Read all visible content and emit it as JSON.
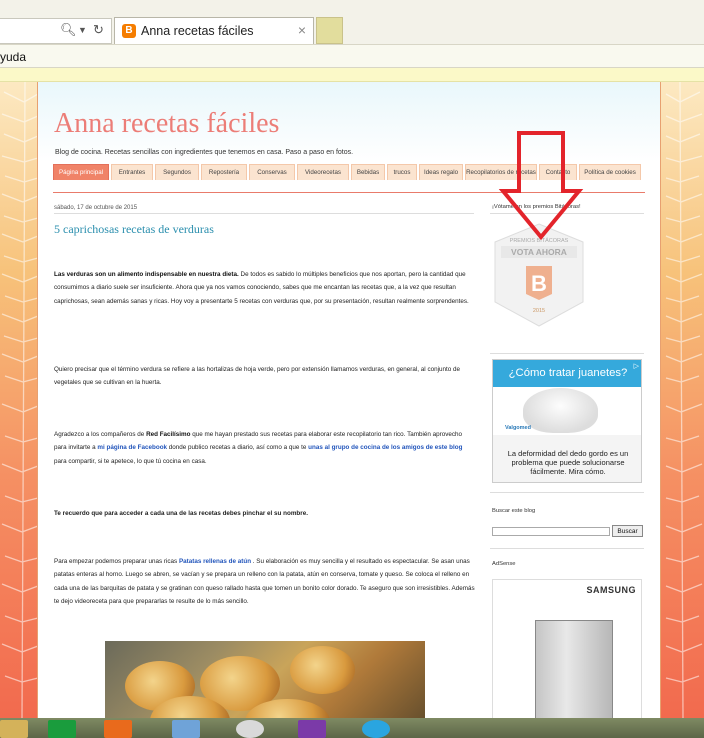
{
  "browser": {
    "tab_title": "Anna recetas fáciles",
    "tab_close": "×",
    "menu_text": "yuda",
    "favicon_letter": "B"
  },
  "blog": {
    "title": "Anna recetas fáciles",
    "description": "Blog de cocina. Recetas sencillas con ingredientes que tenemos en casa. Paso a paso en fotos.",
    "nav_tabs": [
      {
        "label": "Página principal",
        "active": true
      },
      {
        "label": "Entrantes"
      },
      {
        "label": "Segundos"
      },
      {
        "label": "Repostería"
      },
      {
        "label": "Conservas"
      },
      {
        "label": "Videorecetas"
      },
      {
        "label": "Bebidas"
      },
      {
        "label": "trucos"
      },
      {
        "label": "Ideas regalo"
      },
      {
        "label": "Recopilatorios de recetas"
      },
      {
        "label": "Contacto"
      },
      {
        "label": "Política de cookies"
      }
    ]
  },
  "post": {
    "date": "sábado, 17 de octubre de 2015",
    "title": "5 caprichosas recetas de verduras",
    "p1_bold": "Las verduras son un alimento indispensable en nuestra dieta.",
    "p1_rest": " De todos es sabido lo múltiples beneficios que nos aportan, pero la cantidad que consumimos a diario suele ser insuficiente. Ahora que ya nos vamos conociendo, sabes que me encantan las recetas que, a la vez que resultan caprichosas, sean además sanas y ricas. Hoy voy a presentarte 5 recetas con verduras que, por su presentación, resultan realmente sorprendentes.",
    "p2": "Quiero precisar que el término verdura se refiere a las hortalizas de hoja verde, pero por extensión llamamos verduras, en general, al conjunto de vegetales que se cultivan en la huerta.",
    "p3_a": "Agradezco a los compañeros de ",
    "p3_b": "Red Facilísimo",
    "p3_c": " que me hayan prestado sus recetas para elaborar este recopilatorio tan rico. También aprovecho para invitarte a ",
    "p3_link1": "mi página de Facebook",
    "p3_d": " donde publico recetas a diario, así como a que te ",
    "p3_link2": "unas al grupo de cocina de los amigos de este blog",
    "p3_e": " para compartir, si te apetece, lo que tú cocina en casa.",
    "p4": "Te recuerdo que para acceder a cada una de las recetas debes pinchar el su nombre.",
    "p5_a": "Para empezar podemos preparar unas ricas ",
    "p5_link": "Patatas rellenas de atún",
    "p5_b": " . Su elaboración es muy sencilla y el resultado es espectacular. Se asan unas patatas enteras al horno. Luego se abren, se vacían y se prepara un relleno con la patata, atún en conserva, tomate y queso. Se coloca el relleno en cada una de las barquitas de patata y se gratinan con queso rallado hasta que tomen un bonito color dorado. Te aseguro que son irresistibles. Además te dejo videoreceta para que prepararlas te resulte de lo más sencillo."
  },
  "sidebar": {
    "vote_title": "¡Vótame en los premios Bitácoras!",
    "badge_top": "PREMIOS BITÁCORAS",
    "badge_vote": "VOTA AHORA",
    "badge_year": "2015",
    "ad1_headline": "¿Cómo tratar juanetes?",
    "ad1_brand": "Valgomed",
    "ad1_text": "La deformidad del dedo gordo es un problema que puede solucionarse fácilmente. Mira cómo.",
    "search_title": "Buscar este blog",
    "search_button": "Buscar",
    "adsense_title": "AdSense",
    "ad2_brand": "SAMSUNG"
  },
  "colors": {
    "accent_red": "#e3242b",
    "title_pink": "#ec7d77",
    "link_blue": "#2255bb"
  }
}
